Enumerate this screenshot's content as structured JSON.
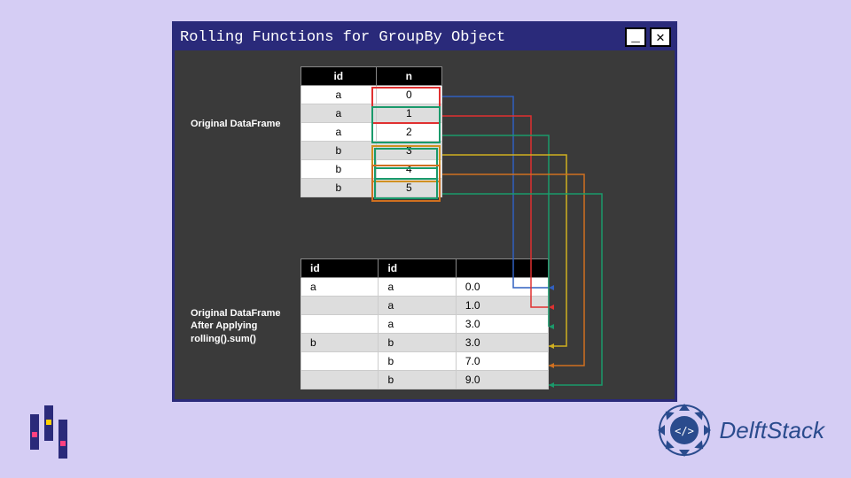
{
  "window": {
    "title": "Rolling Functions for GroupBy Object"
  },
  "labels": {
    "original": "Original DataFrame",
    "after_line1": "Original DataFrame",
    "after_line2": "After Applying",
    "after_line3": "rolling().sum()"
  },
  "table1": {
    "headers": [
      "id",
      "n"
    ],
    "rows": [
      [
        "a",
        "0"
      ],
      [
        "a",
        "1"
      ],
      [
        "a",
        "2"
      ],
      [
        "b",
        "3"
      ],
      [
        "b",
        "4"
      ],
      [
        "b",
        "5"
      ]
    ]
  },
  "table2": {
    "headers": [
      "id",
      "id",
      ""
    ],
    "rows": [
      [
        "a",
        "a",
        "0.0"
      ],
      [
        "",
        "a",
        "1.0"
      ],
      [
        "",
        "a",
        "3.0"
      ],
      [
        "b",
        "b",
        "3.0"
      ],
      [
        "",
        "b",
        "7.0"
      ],
      [
        "",
        "b",
        "9.0"
      ]
    ]
  },
  "colors": {
    "hl": [
      "#e03030",
      "#1a9a6b",
      "#d09020",
      "#1a9a6b",
      "#d07020",
      "#1a9a6b"
    ],
    "conn": [
      "#3060c0",
      "#e03030",
      "#1a9a6b",
      "#d0b020",
      "#d07020",
      "#1a9a6b"
    ]
  },
  "brand": "DelftStack"
}
